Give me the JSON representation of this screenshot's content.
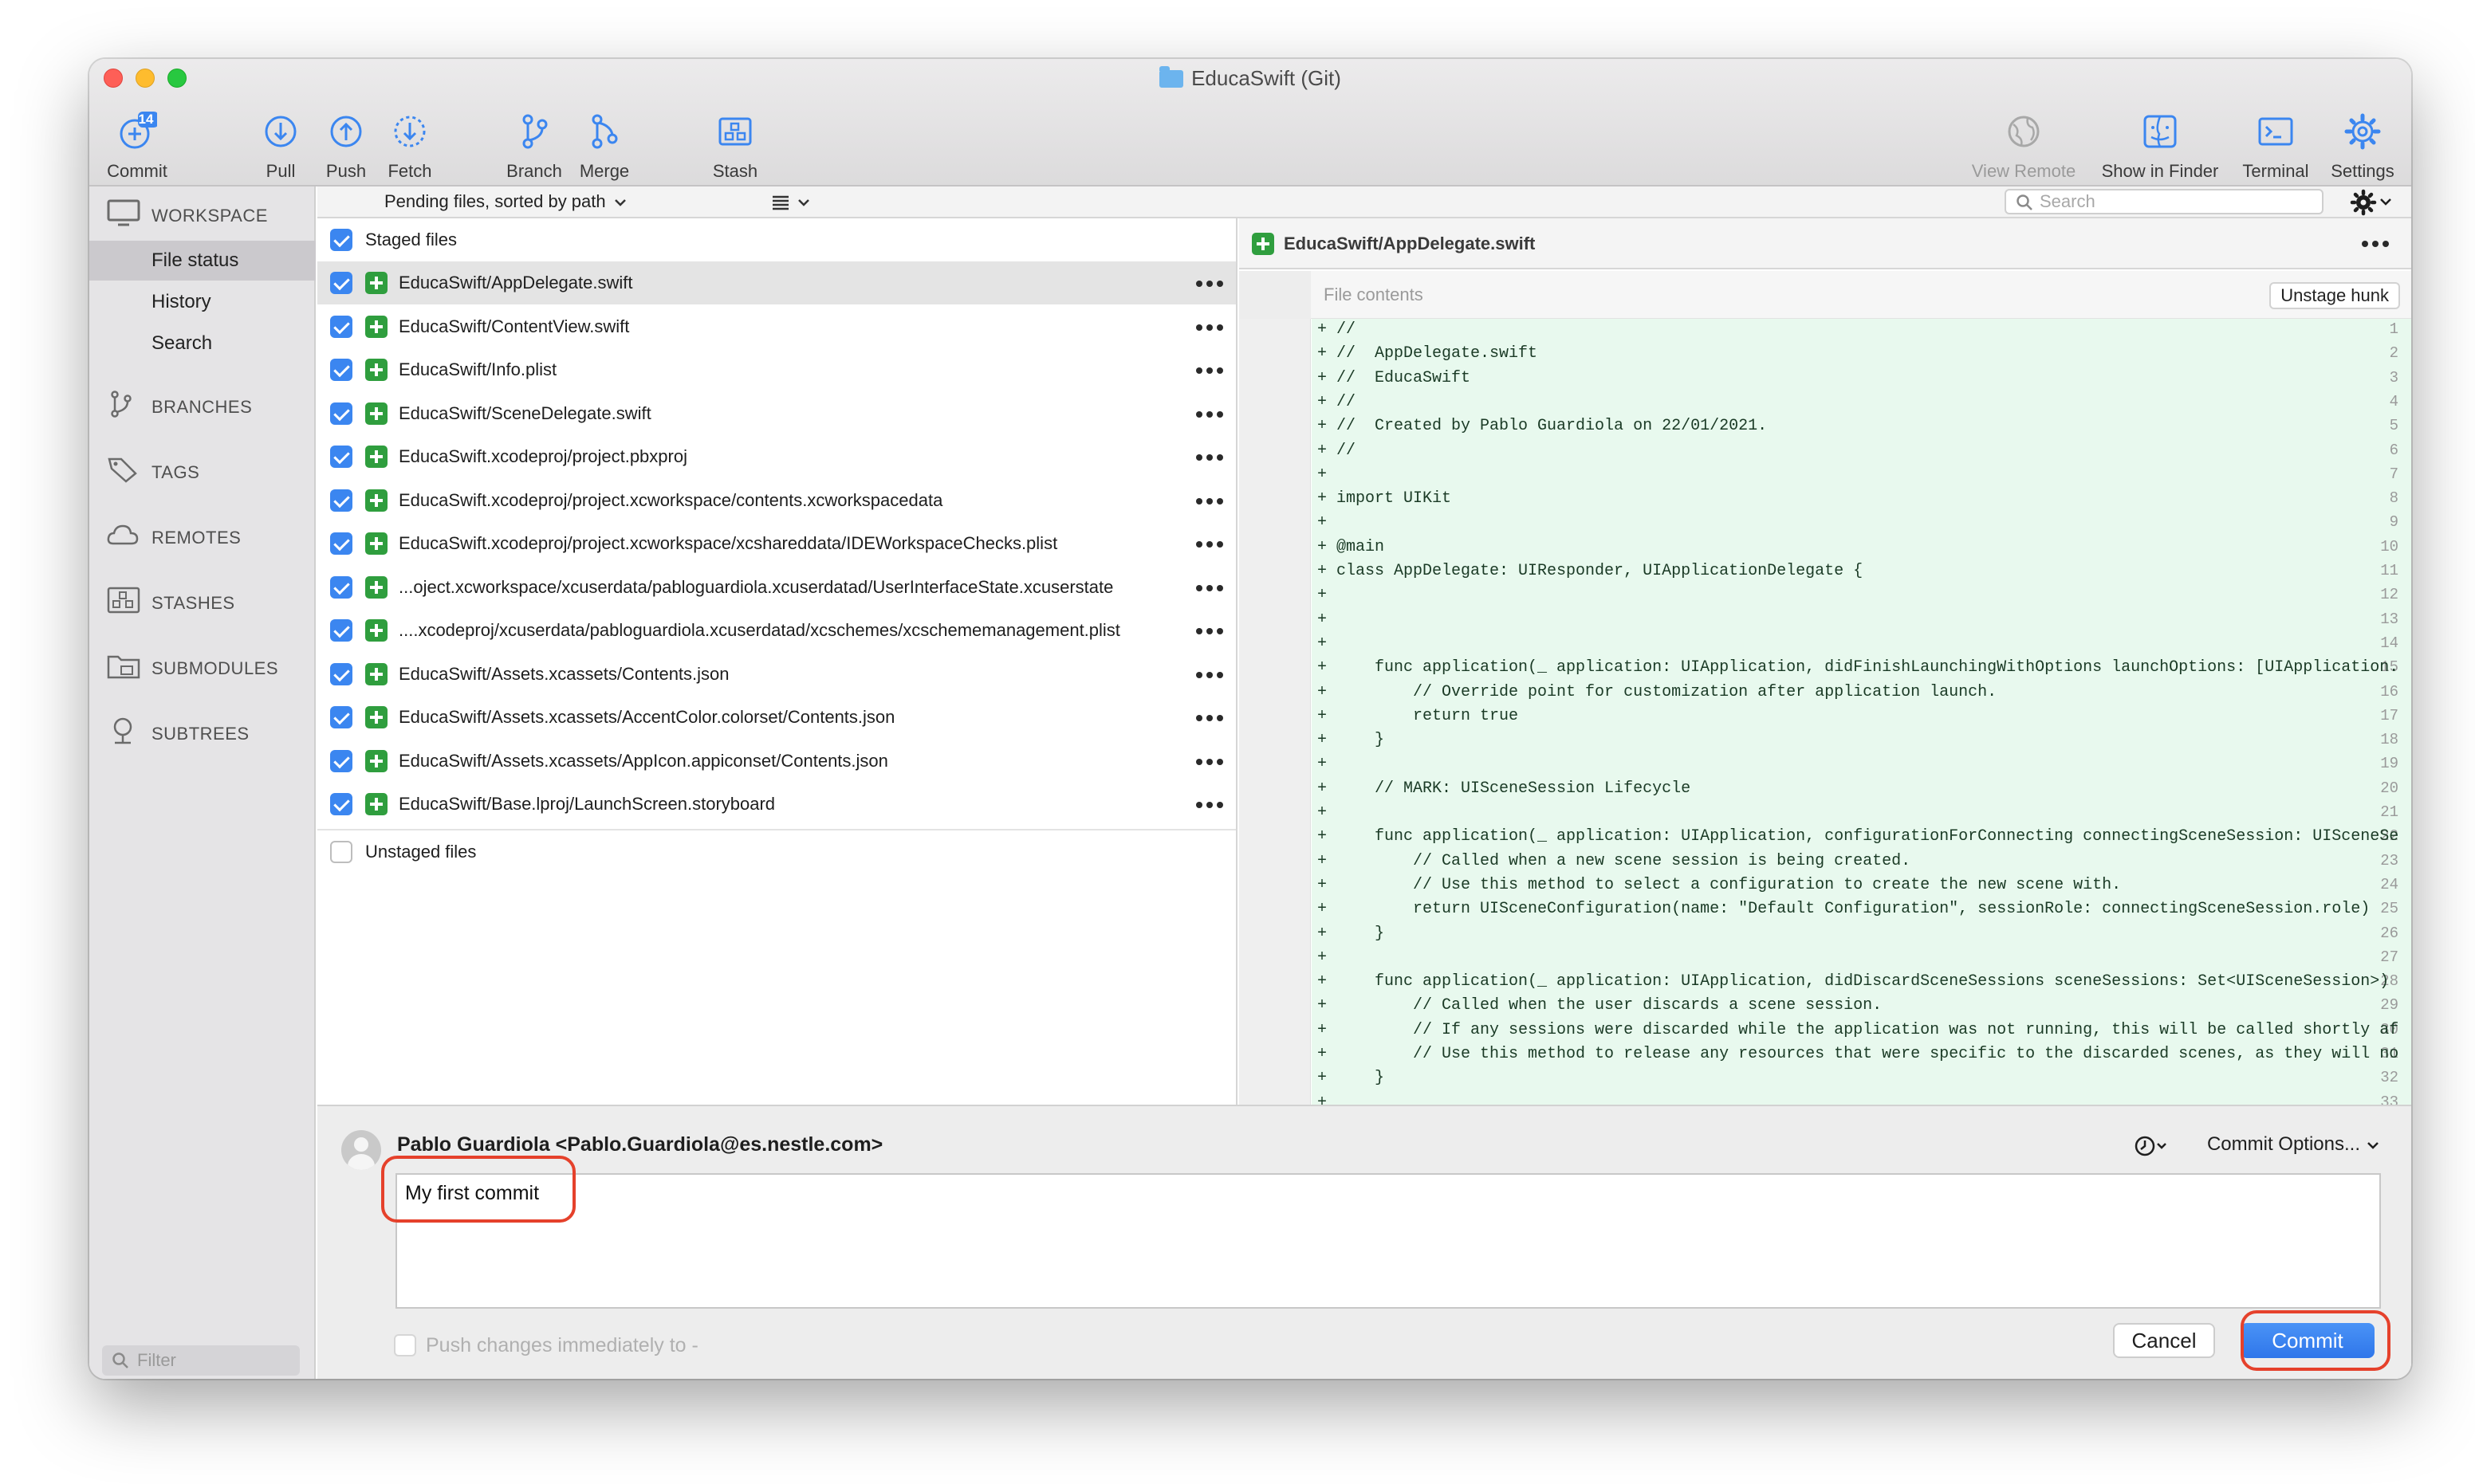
{
  "window": {
    "title": "EducaSwift (Git)"
  },
  "toolbar": {
    "commit": {
      "label": "Commit",
      "badge": "14"
    },
    "pull": "Pull",
    "push": "Push",
    "fetch": "Fetch",
    "branch": "Branch",
    "merge": "Merge",
    "stash": "Stash",
    "view_remote": "View Remote",
    "show_in_finder": "Show in Finder",
    "terminal": "Terminal",
    "settings": "Settings"
  },
  "sidebar": {
    "workspace": "WORKSPACE",
    "items": [
      "File status",
      "History",
      "Search"
    ],
    "branches": "BRANCHES",
    "tags": "TAGS",
    "remotes": "REMOTES",
    "stashes": "STASHES",
    "submodules": "SUBMODULES",
    "subtrees": "SUBTREES",
    "filter_placeholder": "Filter"
  },
  "subbar": {
    "sort": "Pending files, sorted by path",
    "search_placeholder": "Search"
  },
  "staged": {
    "header": "Staged files",
    "files": [
      "EducaSwift/AppDelegate.swift",
      "EducaSwift/ContentView.swift",
      "EducaSwift/Info.plist",
      "EducaSwift/SceneDelegate.swift",
      "EducaSwift.xcodeproj/project.pbxproj",
      "EducaSwift.xcodeproj/project.xcworkspace/contents.xcworkspacedata",
      "EducaSwift.xcodeproj/project.xcworkspace/xcshareddata/IDEWorkspaceChecks.plist",
      "...oject.xcworkspace/xcuserdata/pabloguardiola.xcuserdatad/UserInterfaceState.xcuserstate",
      "....xcodeproj/xcuserdata/pabloguardiola.xcuserdatad/xcschemes/xcschememanagement.plist",
      "EducaSwift/Assets.xcassets/Contents.json",
      "EducaSwift/Assets.xcassets/AccentColor.colorset/Contents.json",
      "EducaSwift/Assets.xcassets/AppIcon.appiconset/Contents.json",
      "EducaSwift/Base.lproj/LaunchScreen.storyboard"
    ]
  },
  "unstaged": {
    "header": "Unstaged files"
  },
  "diff": {
    "file": "EducaSwift/AppDelegate.swift",
    "hunk_label": "File contents",
    "unstage_label": "Unstage hunk",
    "lines": [
      {
        "n": "1",
        "t": "+ //"
      },
      {
        "n": "2",
        "t": "+ //  AppDelegate.swift"
      },
      {
        "n": "3",
        "t": "+ //  EducaSwift"
      },
      {
        "n": "4",
        "t": "+ //"
      },
      {
        "n": "5",
        "t": "+ //  Created by Pablo Guardiola on 22/01/2021."
      },
      {
        "n": "6",
        "t": "+ //"
      },
      {
        "n": "7",
        "t": "+"
      },
      {
        "n": "8",
        "t": "+ import UIKit"
      },
      {
        "n": "9",
        "t": "+"
      },
      {
        "n": "10",
        "t": "+ @main"
      },
      {
        "n": "11",
        "t": "+ class AppDelegate: UIResponder, UIApplicationDelegate {"
      },
      {
        "n": "12",
        "t": "+"
      },
      {
        "n": "13",
        "t": "+"
      },
      {
        "n": "14",
        "t": "+"
      },
      {
        "n": "15",
        "t": "+     func application(_ application: UIApplication, didFinishLaunchingWithOptions launchOptions: [UIApplication."
      },
      {
        "n": "16",
        "t": "+         // Override point for customization after application launch."
      },
      {
        "n": "17",
        "t": "+         return true"
      },
      {
        "n": "18",
        "t": "+     }"
      },
      {
        "n": "19",
        "t": "+"
      },
      {
        "n": "20",
        "t": "+     // MARK: UISceneSession Lifecycle"
      },
      {
        "n": "21",
        "t": "+"
      },
      {
        "n": "22",
        "t": "+     func application(_ application: UIApplication, configurationForConnecting connectingSceneSession: UISceneSe"
      },
      {
        "n": "23",
        "t": "+         // Called when a new scene session is being created."
      },
      {
        "n": "24",
        "t": "+         // Use this method to select a configuration to create the new scene with."
      },
      {
        "n": "25",
        "t": "+         return UISceneConfiguration(name: \"Default Configuration\", sessionRole: connectingSceneSession.role)"
      },
      {
        "n": "26",
        "t": "+     }"
      },
      {
        "n": "27",
        "t": "+"
      },
      {
        "n": "28",
        "t": "+     func application(_ application: UIApplication, didDiscardSceneSessions sceneSessions: Set<UISceneSession>)"
      },
      {
        "n": "29",
        "t": "+         // Called when the user discards a scene session."
      },
      {
        "n": "30",
        "t": "+         // If any sessions were discarded while the application was not running, this will be called shortly af"
      },
      {
        "n": "31",
        "t": "+         // Use this method to release any resources that were specific to the discarded scenes, as they will no"
      },
      {
        "n": "32",
        "t": "+     }"
      },
      {
        "n": "33",
        "t": "+"
      }
    ]
  },
  "commit": {
    "author": "Pablo Guardiola <Pablo.Guardiola@es.nestle.com>",
    "options": "Commit Options...",
    "message": "My first commit",
    "push_label": "Push changes immediately to -",
    "cancel": "Cancel",
    "commit": "Commit"
  }
}
